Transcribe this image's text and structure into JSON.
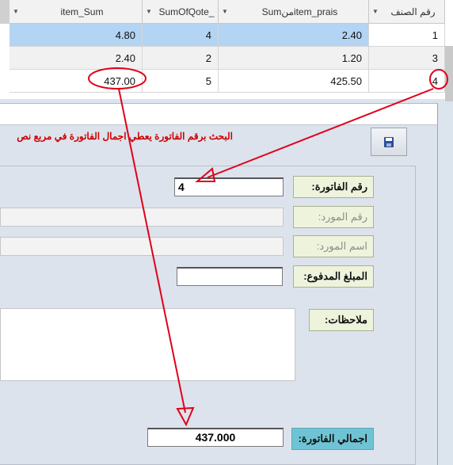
{
  "grid": {
    "columns": [
      "رقم الصنف",
      "Sumمنitem_prais",
      "SumOfQote_",
      "item_Sum"
    ],
    "rows": [
      {
        "id": "1",
        "prais": "2.40",
        "qty": "4",
        "sum": "4.80"
      },
      {
        "id": "3",
        "prais": "1.20",
        "qty": "2",
        "sum": "2.40"
      },
      {
        "id": "4",
        "prais": "425.50",
        "qty": "5",
        "sum": "437.00"
      }
    ]
  },
  "form": {
    "hint": "البحث برقم الفاتورة يعطي اجمال الفاتورة في مربع نص",
    "invoice_no_label": "رقم الفاتورة:",
    "invoice_no_value": "4",
    "supplier_no_label": "رقم المورد:",
    "supplier_name_label": "اسم المورد:",
    "paid_label": "المبلغ المدفوع:",
    "notes_label": "ملاحظات:",
    "total_label": "اجمالي الفاتورة:",
    "total_value": "437.000"
  },
  "colors": {
    "annotation": "#e0001a",
    "selected_row": "#b3d4f3",
    "label_bg": "#eef3dc",
    "total_label_bg": "#6ec4d4"
  },
  "icons": {
    "save": "floppy-disk-icon",
    "sort": "dropdown-arrow-icon"
  }
}
